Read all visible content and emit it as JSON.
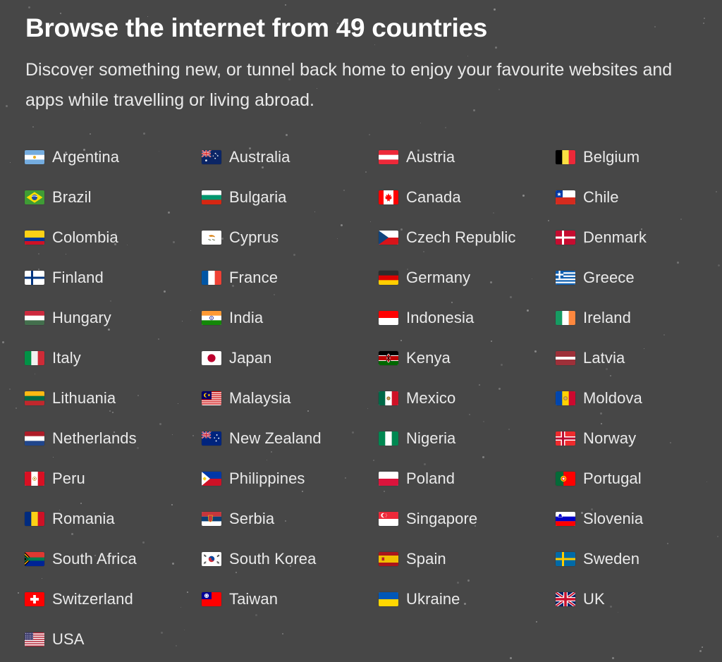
{
  "hero": {
    "title": "Browse the internet from 49 countries",
    "subtitle": "Discover something new, or tunnel back home to enjoy your favourite websites and apps while travelling or living abroad."
  },
  "theme": {
    "background": "#474747",
    "title_color": "#ffffff",
    "text_color": "#eaeaea",
    "star_color": "#b9b9b9"
  },
  "countries": [
    {
      "name": "Argentina",
      "flag": "flag-argentina"
    },
    {
      "name": "Australia",
      "flag": "flag-australia"
    },
    {
      "name": "Austria",
      "flag": "flag-austria"
    },
    {
      "name": "Belgium",
      "flag": "flag-belgium"
    },
    {
      "name": "Brazil",
      "flag": "flag-brazil"
    },
    {
      "name": "Bulgaria",
      "flag": "flag-bulgaria"
    },
    {
      "name": "Canada",
      "flag": "flag-canada"
    },
    {
      "name": "Chile",
      "flag": "flag-chile"
    },
    {
      "name": "Colombia",
      "flag": "flag-colombia"
    },
    {
      "name": "Cyprus",
      "flag": "flag-cyprus"
    },
    {
      "name": "Czech Republic",
      "flag": "flag-czech-republic"
    },
    {
      "name": "Denmark",
      "flag": "flag-denmark"
    },
    {
      "name": "Finland",
      "flag": "flag-finland"
    },
    {
      "name": "France",
      "flag": "flag-france"
    },
    {
      "name": "Germany",
      "flag": "flag-germany"
    },
    {
      "name": "Greece",
      "flag": "flag-greece"
    },
    {
      "name": "Hungary",
      "flag": "flag-hungary"
    },
    {
      "name": "India",
      "flag": "flag-india"
    },
    {
      "name": "Indonesia",
      "flag": "flag-indonesia"
    },
    {
      "name": "Ireland",
      "flag": "flag-ireland"
    },
    {
      "name": "Italy",
      "flag": "flag-italy"
    },
    {
      "name": "Japan",
      "flag": "flag-japan"
    },
    {
      "name": "Kenya",
      "flag": "flag-kenya"
    },
    {
      "name": "Latvia",
      "flag": "flag-latvia"
    },
    {
      "name": "Lithuania",
      "flag": "flag-lithuania"
    },
    {
      "name": "Malaysia",
      "flag": "flag-malaysia"
    },
    {
      "name": "Mexico",
      "flag": "flag-mexico"
    },
    {
      "name": "Moldova",
      "flag": "flag-moldova"
    },
    {
      "name": "Netherlands",
      "flag": "flag-netherlands"
    },
    {
      "name": "New Zealand",
      "flag": "flag-new-zealand"
    },
    {
      "name": "Nigeria",
      "flag": "flag-nigeria"
    },
    {
      "name": "Norway",
      "flag": "flag-norway"
    },
    {
      "name": "Peru",
      "flag": "flag-peru"
    },
    {
      "name": "Philippines",
      "flag": "flag-philippines"
    },
    {
      "name": "Poland",
      "flag": "flag-poland"
    },
    {
      "name": "Portugal",
      "flag": "flag-portugal"
    },
    {
      "name": "Romania",
      "flag": "flag-romania"
    },
    {
      "name": "Serbia",
      "flag": "flag-serbia"
    },
    {
      "name": "Singapore",
      "flag": "flag-singapore"
    },
    {
      "name": "Slovenia",
      "flag": "flag-slovenia"
    },
    {
      "name": "South Africa",
      "flag": "flag-south-africa"
    },
    {
      "name": "South Korea",
      "flag": "flag-south-korea"
    },
    {
      "name": "Spain",
      "flag": "flag-spain"
    },
    {
      "name": "Sweden",
      "flag": "flag-sweden"
    },
    {
      "name": "Switzerland",
      "flag": "flag-switzerland"
    },
    {
      "name": "Taiwan",
      "flag": "flag-taiwan"
    },
    {
      "name": "Ukraine",
      "flag": "flag-ukraine"
    },
    {
      "name": "UK",
      "flag": "flag-uk"
    },
    {
      "name": "USA",
      "flag": "flag-usa"
    }
  ]
}
